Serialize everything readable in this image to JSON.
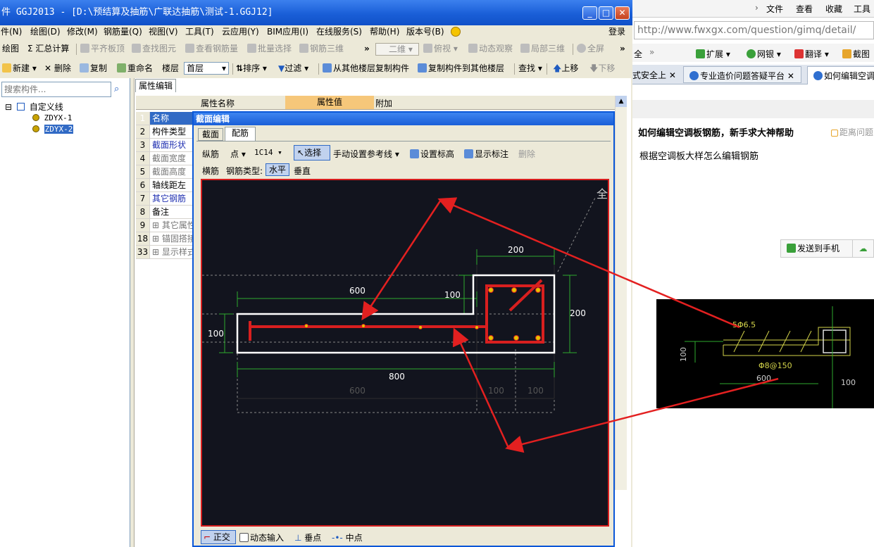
{
  "app": {
    "title": "件 GGJ2013 - [D:\\预结算及抽筋\\广联达抽筋\\测试-1.GGJ12]",
    "window_buttons": {
      "minimize": "_",
      "maximize": "□",
      "close": "✕"
    },
    "menu": [
      "件(N)",
      "绘图(D)",
      "修改(M)",
      "钢筋量(Q)",
      "视图(V)",
      "工具(T)",
      "云应用(Y)",
      "BIM应用(I)",
      "在线服务(S)",
      "帮助(H)",
      "版本号(B)"
    ],
    "login": "登录",
    "toolbar1": {
      "items": [
        "绘图",
        "Σ 汇总计算",
        "平齐板顶",
        "查找图元",
        "查看钢筋量",
        "批量选择",
        "钢筋三维"
      ],
      "more": "»",
      "view_select": "二维",
      "items2": [
        "俯视",
        "动态观察",
        "局部三维",
        "全屏"
      ],
      "more2": "»"
    },
    "toolbar2": {
      "new": "新建",
      "delete": "删除",
      "copy": "复制",
      "rename": "重命名",
      "floor_label": "楼层",
      "floor_value": "首层",
      "sort": "排序",
      "filter": "过滤",
      "copy_from": "从其他楼层复制构件",
      "copy_to": "复制构件到其他楼层",
      "find": "查找",
      "up": "上移",
      "down": "下移"
    },
    "left_panel": {
      "search_placeholder": "搜索构件...",
      "tree_root": "自定义线",
      "tree_items": [
        "ZDYX-1",
        "ZDYX-2"
      ],
      "expand_sign": "⊟"
    },
    "prop_panel": {
      "tab": "属性编辑",
      "headers": {
        "name": "属性名称",
        "value": "属性值",
        "extra": "附加"
      },
      "rows": [
        {
          "n": "1",
          "label": "名称"
        },
        {
          "n": "2",
          "label": "构件类型"
        },
        {
          "n": "3",
          "label": "截面形状"
        },
        {
          "n": "4",
          "label": "截面宽度"
        },
        {
          "n": "5",
          "label": "截面高度"
        },
        {
          "n": "6",
          "label": "轴线距左"
        },
        {
          "n": "7",
          "label": "其它钢筋"
        },
        {
          "n": "8",
          "label": "备注"
        },
        {
          "n": "9",
          "label": "⊞ 其它属性"
        },
        {
          "n": "18",
          "label": "⊞ 锚固搭接"
        },
        {
          "n": "33",
          "label": "⊞ 显示样式"
        }
      ]
    },
    "dialog": {
      "title": "截面编辑",
      "tabs": [
        "截面",
        "配筋"
      ],
      "row1": {
        "longitudinal": "纵筋",
        "point": "点",
        "bar_spec": "1C14",
        "select": "选择",
        "manual_ref": "手动设置参考线",
        "set_elev": "设置标高",
        "show_dim": "显示标注",
        "delete": "删除"
      },
      "row2": {
        "transverse": "横筋",
        "type_label": "钢筋类型:",
        "horizontal": "水平",
        "vertical": "垂直"
      },
      "canvas": {
        "dims": {
          "top_200": "200",
          "w_600": "600",
          "step_100": "100",
          "h_200": "200",
          "h_100": "100",
          "w_800": "800",
          "b_600": "600",
          "b_100a": "100",
          "b_100b": "100"
        },
        "corner_text": "全"
      },
      "status": [
        "正交",
        "动态输入",
        "垂点",
        "中点"
      ]
    }
  },
  "browser": {
    "menu": [
      "文件",
      "查看",
      "收藏",
      "工具"
    ],
    "address": "http://www.fwxgx.com/question/gimq/detail/",
    "toolbar": {
      "full": "全",
      "more": "»",
      "ext": "扩展",
      "bank": "网银",
      "translate": "翻译",
      "screenshot": "截图"
    },
    "tabs": [
      "式安全上",
      "专业造价问题答疑平台",
      "如何编辑空调"
    ],
    "send_to_phone": "发送到手机",
    "question_title": "如何编辑空调板钢筋，新手求大神帮助",
    "question_meta": "距离问题",
    "question_body": "根据空调板大样怎么编辑钢筋",
    "image": {
      "label1": "5Φ6.5",
      "label2": "Φ8@150",
      "dim_600": "600",
      "dim_100": "100",
      "dim_100v": "100"
    }
  },
  "colors": {
    "accent_red": "#e32020",
    "cad_bg": "#12141e",
    "xp_blue": "#1a5fd8"
  }
}
